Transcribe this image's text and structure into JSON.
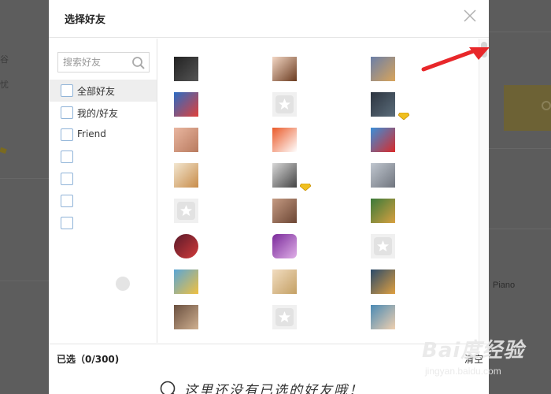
{
  "dialog": {
    "title": "选择好友",
    "search_placeholder": "搜索好友",
    "groups": [
      {
        "label": "全部好友"
      },
      {
        "label": "我的/好友"
      },
      {
        "label": "Friend"
      },
      {
        "label": ""
      },
      {
        "label": ""
      },
      {
        "label": ""
      },
      {
        "label": ""
      },
      {
        "label": ""
      }
    ],
    "selected_label": "已选（0/300)",
    "clear_label": "清空",
    "empty_message": "这里还没有已选的好友哦！"
  },
  "background": {
    "right_text": "Piano"
  },
  "watermark": {
    "brand": "Bai度经验",
    "url": "jingyan.baidu.com"
  },
  "colors": {
    "overlay": "#5b5b5b",
    "checkbox_border": "#8fb3d8",
    "arrow": "#e8272a",
    "active_row": "#eeeeee"
  },
  "friends": [
    {
      "icon": "dark-car-avatar"
    },
    {
      "icon": "cartoon-boy-avatar"
    },
    {
      "icon": "anime-character-avatar"
    },
    {
      "icon": "colorful-logo-avatar"
    },
    {
      "icon": "default-star-avatar"
    },
    {
      "icon": "dark-landscape-avatar",
      "badge": "vip-diamond-icon"
    },
    {
      "icon": "cartoon-hand-avatar"
    },
    {
      "icon": "discount-tag-avatar"
    },
    {
      "icon": "red-bird-avatar"
    },
    {
      "icon": "hanging-doll-avatar"
    },
    {
      "icon": "sunglasses-man-avatar",
      "badge": "vip-crown-icon"
    },
    {
      "icon": "sketch-girl-avatar"
    },
    {
      "icon": "default-star-avatar"
    },
    {
      "icon": "long-hair-girl-avatar"
    },
    {
      "icon": "game-character-avatar"
    },
    {
      "icon": "red-anime-avatar"
    },
    {
      "icon": "purple-cartoon-avatar"
    },
    {
      "icon": "default-star-avatar"
    },
    {
      "icon": "cartoon-boy-blue-avatar"
    },
    {
      "icon": "blonde-anime-avatar"
    },
    {
      "icon": "sunset-avatar"
    },
    {
      "icon": "man-portrait-avatar"
    },
    {
      "icon": "default-star-avatar"
    },
    {
      "icon": "cartoon-man-avatar"
    }
  ]
}
